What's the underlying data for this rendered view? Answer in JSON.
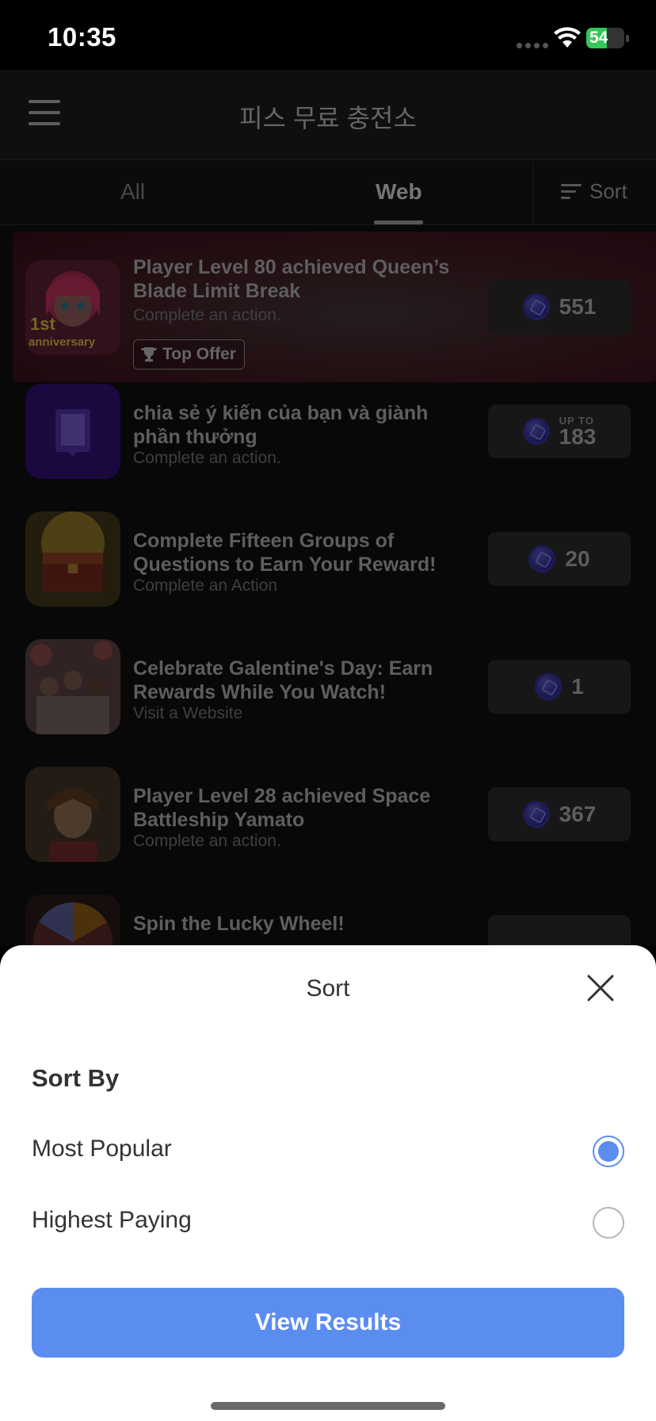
{
  "status_bar": {
    "time": "10:35",
    "battery": "54",
    "battery_level": 0.54
  },
  "header": {
    "title": "피스 무료 충전소"
  },
  "tabs": {
    "all": "All",
    "web": "Web",
    "sort": "Sort"
  },
  "offers": [
    {
      "title": "Player Level 80 achieved Queen’s Blade Limit Break",
      "subtitle": "Complete an action.",
      "badge": "Top Offer",
      "reward": "551",
      "thumb_icon": "anime-girl-thumbnail",
      "thumb_text_1": "1st",
      "thumb_text_2": "anniversary"
    },
    {
      "title": "chia sẻ ý kiến của bạn và giành phần thưởng",
      "subtitle": "Complete an action.",
      "reward_prefix": "UP TO",
      "reward": "183",
      "thumb_icon": "chat-bubble-thumbnail"
    },
    {
      "title": "Complete Fifteen Groups of Questions to Earn Your Reward!",
      "subtitle": "Complete an Action",
      "reward": "20",
      "thumb_icon": "treasure-chest-thumbnail"
    },
    {
      "title": "Celebrate Galentine's Day: Earn Rewards While You Watch!",
      "subtitle": "Visit a Website",
      "reward": "1",
      "thumb_icon": "party-photo-thumbnail"
    },
    {
      "title": "Player Level 28 achieved Space Battleship Yamato",
      "subtitle": "Complete an action.",
      "reward": "367",
      "thumb_icon": "anime-boy-thumbnail"
    },
    {
      "title": "Spin the Lucky Wheel!",
      "thumb_icon": "wheel-thumbnail"
    }
  ],
  "sheet": {
    "title": "Sort",
    "section_label": "Sort By",
    "options": [
      {
        "label": "Most Popular",
        "selected": true
      },
      {
        "label": "Highest Paying",
        "selected": false
      }
    ],
    "button": "View Results"
  },
  "colors": {
    "accent": "#5b8df0",
    "battery": "#34c759"
  }
}
